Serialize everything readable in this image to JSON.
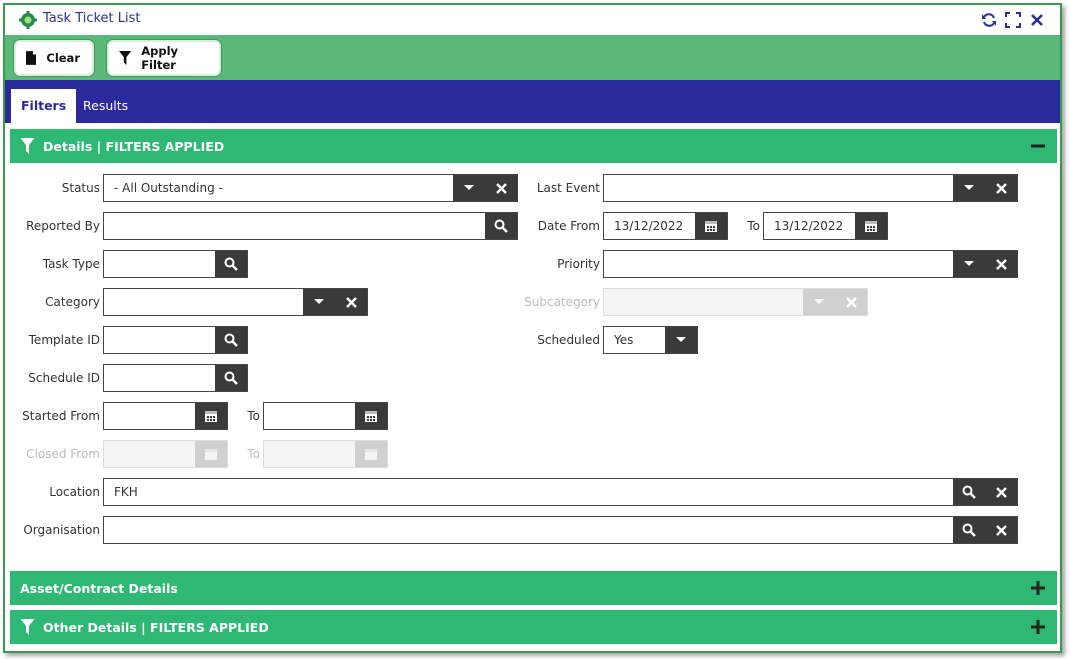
{
  "window": {
    "title": "Task Ticket List",
    "icons": [
      "gear-icon",
      "refresh-icon",
      "fullscreen-icon",
      "close-icon"
    ]
  },
  "toolbar": {
    "clear_label": "Clear",
    "apply_label": "Apply Filter"
  },
  "tabs": [
    {
      "label": "Filters",
      "active": true
    },
    {
      "label": "Results",
      "active": false
    }
  ],
  "sections": {
    "details": "Details | FILTERS APPLIED",
    "asset": "Asset/Contract Details",
    "other": "Other Details | FILTERS APPLIED"
  },
  "fields": {
    "status": {
      "label": "Status",
      "value": "- All Outstanding -"
    },
    "last_event": {
      "label": "Last Event",
      "value": ""
    },
    "reported_by": {
      "label": "Reported By",
      "value": ""
    },
    "date_from": {
      "label": "Date From",
      "value": "13/12/2022"
    },
    "date_to": {
      "label": "To",
      "value": "13/12/2022"
    },
    "task_type": {
      "label": "Task Type",
      "value": ""
    },
    "priority": {
      "label": "Priority",
      "value": ""
    },
    "category": {
      "label": "Category",
      "value": ""
    },
    "subcategory": {
      "label": "Subcategory",
      "value": "",
      "disabled": true
    },
    "template_id": {
      "label": "Template ID",
      "value": ""
    },
    "scheduled": {
      "label": "Scheduled",
      "value": "Yes"
    },
    "schedule_id": {
      "label": "Schedule ID",
      "value": ""
    },
    "started_from": {
      "label": "Started From",
      "value": ""
    },
    "started_to": {
      "label": "To",
      "value": ""
    },
    "closed_from": {
      "label": "Closed From",
      "value": "",
      "disabled": true
    },
    "closed_to": {
      "label": "To",
      "value": "",
      "disabled": true
    },
    "location": {
      "label": "Location",
      "value": "FKH"
    },
    "organisation": {
      "label": "Organisation",
      "value": ""
    }
  },
  "colors": {
    "brand_green": "#5cb878",
    "section_green": "#2eb873",
    "tab_bar_blue": "#2b2a9c",
    "title_text": "#2e2f8f"
  }
}
